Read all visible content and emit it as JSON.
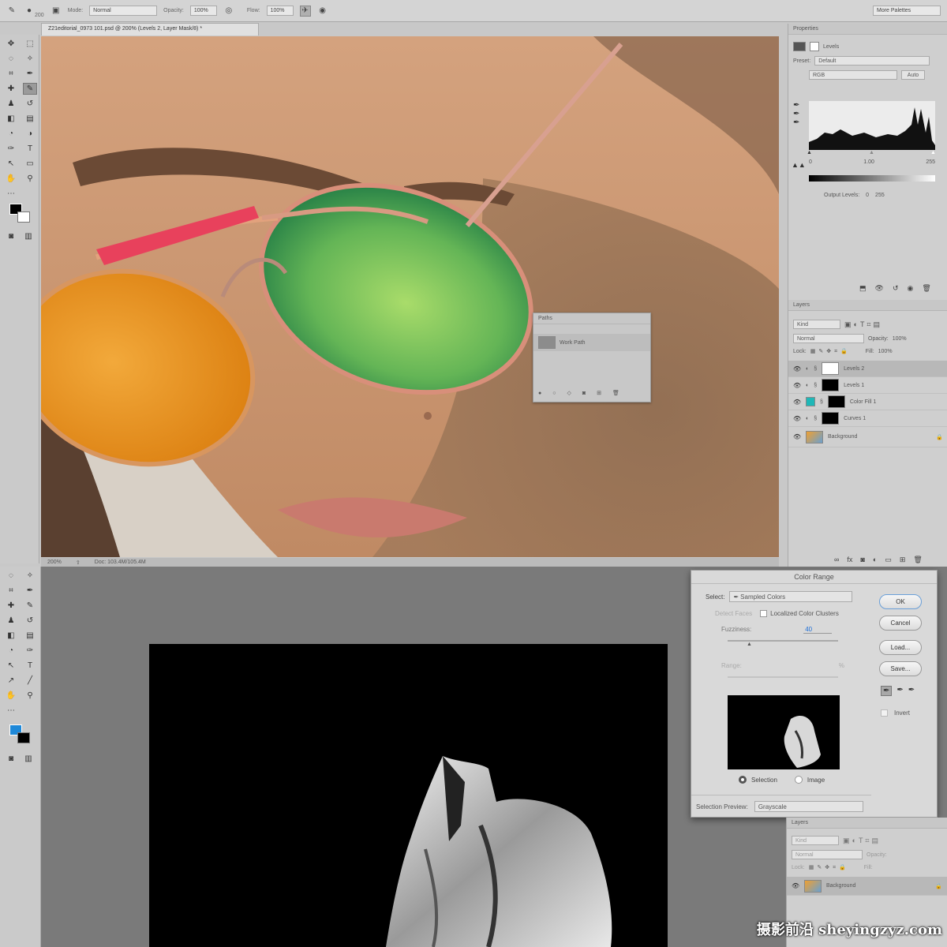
{
  "options_bar": {
    "brush_size": "200",
    "mode_label": "Mode:",
    "mode_value": "Normal",
    "opacity_label": "Opacity:",
    "opacity_value": "100%",
    "flow_label": "Flow:",
    "flow_value": "100%",
    "more_palettes": "More Palettes"
  },
  "document": {
    "tab_title": "Z21editorial_0973 101.psd @ 200% (Levels 2, Layer Mask/8) *",
    "zoom": "200%",
    "doc_size": "Doc: 103.4M/105.4M"
  },
  "properties": {
    "panel_title": "Properties",
    "adjustment": "Levels",
    "preset_label": "Preset:",
    "preset_value": "Default",
    "channel": "RGB",
    "auto": "Auto",
    "input_black": "0",
    "input_gamma": "1.00",
    "input_white": "255",
    "output_label": "Output Levels:",
    "output_black": "0",
    "output_white": "255"
  },
  "layers_top": {
    "panel_title": "Layers",
    "filter": "Kind",
    "blend": "Normal",
    "opacity_label": "Opacity:",
    "opacity": "100%",
    "lock_label": "Lock:",
    "fill_label": "Fill:",
    "fill": "100%",
    "items": [
      {
        "name": "Levels 2",
        "thumb": "#ffffff"
      },
      {
        "name": "Levels 1",
        "thumb": "#000000"
      },
      {
        "name": "Color Fill 1",
        "thumb": "#000000"
      },
      {
        "name": "Curves 1",
        "thumb": "#000000"
      },
      {
        "name": "Background",
        "thumb": "#b5844f"
      }
    ]
  },
  "paths": {
    "panel_title": "Paths",
    "item": "Work Path"
  },
  "color_range": {
    "title": "Color Range",
    "select_label": "Select:",
    "select_value": "Sampled Colors",
    "detect_faces": "Detect Faces",
    "localized": "Localized Color Clusters",
    "fuzziness_label": "Fuzziness:",
    "fuzziness_value": "40",
    "range_label": "Range:",
    "range_unit": "%",
    "fuzziness_slider_fraction": 0.2,
    "selection_option": "Selection",
    "image_option": "Image",
    "preview_label": "Selection Preview:",
    "preview_value": "Grayscale",
    "ok": "OK",
    "cancel": "Cancel",
    "load": "Load...",
    "save": "Save...",
    "invert": "Invert"
  },
  "layers_bottom": {
    "panel_title": "Layers",
    "filter": "Kind",
    "blend": "Normal",
    "opacity_label": "Opacity:",
    "lock_label": "Lock:",
    "fill_label": "Fill:",
    "layer": "Background"
  },
  "watermark": "摄影前沿 sheyingzyz.com",
  "colors": {
    "accent_blue": "#1e88d8",
    "color_fill_teal": "#1fb7b7"
  }
}
